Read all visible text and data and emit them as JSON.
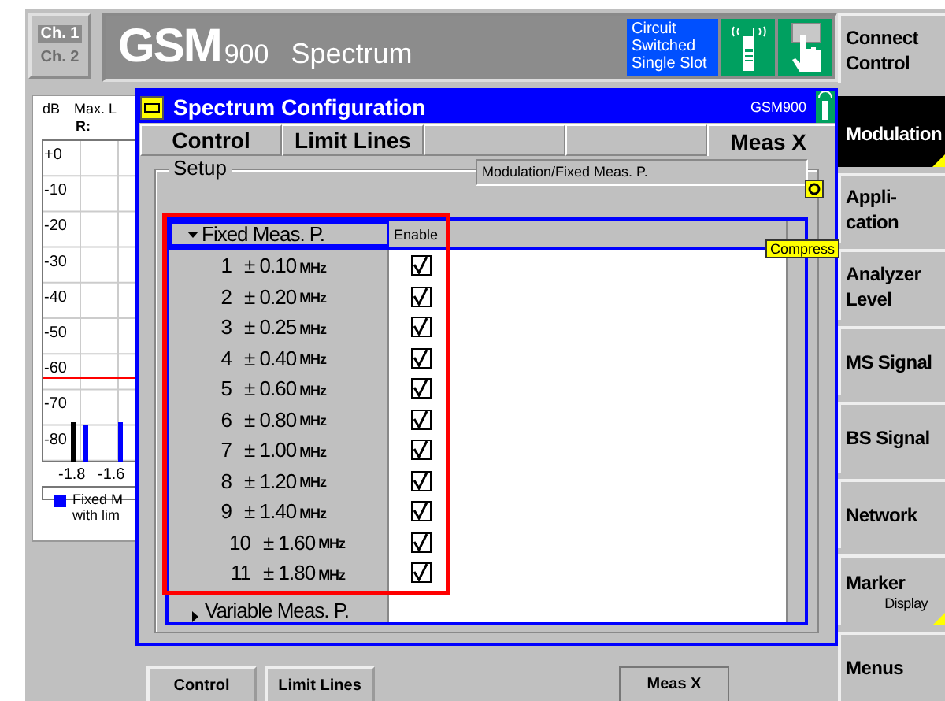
{
  "header": {
    "channels": [
      {
        "label": "Ch. 1",
        "selected": true
      },
      {
        "label": "Ch. 2",
        "selected": false
      }
    ],
    "standard": "GSM",
    "band": "900",
    "title": "Spectrum",
    "status_lines": [
      "Circuit",
      "Switched",
      "Single Slot"
    ]
  },
  "connect_key": {
    "lines": [
      "Connect",
      "Control"
    ]
  },
  "chart": {
    "unit": "dB",
    "trace_label": "Max. L",
    "marker": "R:",
    "y_labels": [
      "+0",
      "-10",
      "-20",
      "-30",
      "-40",
      "-50",
      "-60",
      "-70",
      "-80"
    ],
    "x_labels": [
      "-1.8",
      "-1.6"
    ],
    "legend_lines": [
      "Fixed M",
      "with lim"
    ]
  },
  "dialog": {
    "title": "Spectrum Configuration",
    "band": "GSM900",
    "tabs": [
      {
        "kind": "tab",
        "label": "Control",
        "selected": false
      },
      {
        "kind": "tab",
        "label": "Limit Lines",
        "selected": false
      },
      {
        "kind": "blank"
      },
      {
        "kind": "blank"
      },
      {
        "kind": "tab",
        "label": "Meas X",
        "selected": true
      }
    ],
    "highlight_frame": true,
    "group_title": "Setup",
    "path": "Modulation/Fixed Meas. P.",
    "compress_label": "Compress",
    "enable_column": "Enable",
    "tree": [
      {
        "label": "Fixed Meas. P.",
        "expanded": true,
        "selected": true,
        "children": [
          {
            "number": "1",
            "offset": "± 0.10",
            "unit": "MHz",
            "enabled": true
          },
          {
            "number": "2",
            "offset": "± 0.20",
            "unit": "MHz",
            "enabled": true
          },
          {
            "number": "3",
            "offset": "± 0.25",
            "unit": "MHz",
            "enabled": true
          },
          {
            "number": "4",
            "offset": "± 0.40",
            "unit": "MHz",
            "enabled": true
          },
          {
            "number": "5",
            "offset": "± 0.60",
            "unit": "MHz",
            "enabled": true
          },
          {
            "number": "6",
            "offset": "± 0.80",
            "unit": "MHz",
            "enabled": true
          },
          {
            "number": "7",
            "offset": "± 1.00",
            "unit": "MHz",
            "enabled": true
          },
          {
            "number": "8",
            "offset": "± 1.20",
            "unit": "MHz",
            "enabled": true
          },
          {
            "number": "9",
            "offset": "± 1.40",
            "unit": "MHz",
            "enabled": true
          },
          {
            "number": "10",
            "offset": "± 1.60",
            "unit": "MHz",
            "enabled": true
          },
          {
            "number": "11",
            "offset": "± 1.80",
            "unit": "MHz",
            "enabled": true
          }
        ]
      },
      {
        "label": "Variable Meas. P.",
        "expanded": false,
        "selected": false
      }
    ]
  },
  "softkeys": [
    {
      "lines": [
        "Modulation"
      ],
      "selected": true
    },
    {
      "lines": [
        "Appli-",
        "cation"
      ],
      "selected": false
    },
    {
      "lines": [
        "Analyzer",
        "Level"
      ],
      "selected": false
    },
    {
      "lines": [
        "MS Signal"
      ],
      "selected": false
    },
    {
      "lines": [
        "BS Signal"
      ],
      "selected": false
    },
    {
      "lines": [
        "Network"
      ],
      "selected": false
    },
    {
      "lines": [
        "Marker"
      ],
      "sub": "Display",
      "selected": false
    },
    {
      "lines": [
        "Menus"
      ],
      "selected": false
    }
  ],
  "hotkeys": [
    {
      "kind": "key",
      "label": "Control",
      "selected": false
    },
    {
      "kind": "key",
      "label": "Limit Lines",
      "selected": false
    },
    {
      "kind": "blank"
    },
    {
      "kind": "blank"
    },
    {
      "kind": "key",
      "label": "Meas X",
      "selected": true
    },
    {
      "kind": "blank"
    }
  ]
}
